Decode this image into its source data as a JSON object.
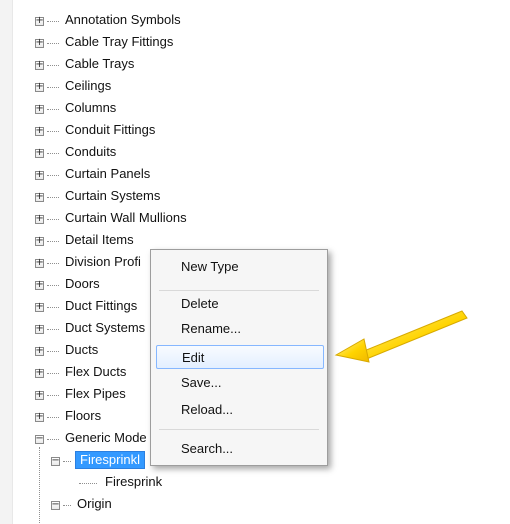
{
  "tree": {
    "items": [
      {
        "label": "Annotation Symbols",
        "state": "collapsed"
      },
      {
        "label": "Cable Tray Fittings",
        "state": "collapsed"
      },
      {
        "label": "Cable Trays",
        "state": "collapsed"
      },
      {
        "label": "Ceilings",
        "state": "collapsed"
      },
      {
        "label": "Columns",
        "state": "collapsed"
      },
      {
        "label": "Conduit Fittings",
        "state": "collapsed"
      },
      {
        "label": "Conduits",
        "state": "collapsed"
      },
      {
        "label": "Curtain Panels",
        "state": "collapsed"
      },
      {
        "label": "Curtain Systems",
        "state": "collapsed"
      },
      {
        "label": "Curtain Wall Mullions",
        "state": "collapsed"
      },
      {
        "label": "Detail Items",
        "state": "collapsed"
      },
      {
        "label": "Division Profi",
        "state": "collapsed"
      },
      {
        "label": "Doors",
        "state": "collapsed"
      },
      {
        "label": "Duct Fittings",
        "state": "collapsed"
      },
      {
        "label": "Duct Systems",
        "state": "collapsed"
      },
      {
        "label": "Ducts",
        "state": "collapsed"
      },
      {
        "label": "Flex Ducts",
        "state": "collapsed"
      },
      {
        "label": "Flex Pipes",
        "state": "collapsed"
      },
      {
        "label": "Floors",
        "state": "collapsed"
      },
      {
        "label": "Generic Mode",
        "state": "expanded"
      }
    ],
    "children": {
      "selected_family": {
        "label": "Firesprinkl",
        "selected": true
      },
      "selected_family_type": {
        "label": "Firesprink"
      },
      "next_family": {
        "label": "Origin",
        "state": "expanded"
      }
    }
  },
  "context_menu": {
    "items": [
      {
        "label": "New Type"
      },
      {
        "label": "Delete"
      },
      {
        "label": "Rename..."
      },
      {
        "label": "Edit",
        "active": true
      },
      {
        "label": "Save..."
      },
      {
        "label": "Reload..."
      },
      {
        "label": "Search..."
      }
    ]
  },
  "annotation": {
    "color": "#ffd400",
    "icon": "arrow-pointer-icon"
  }
}
